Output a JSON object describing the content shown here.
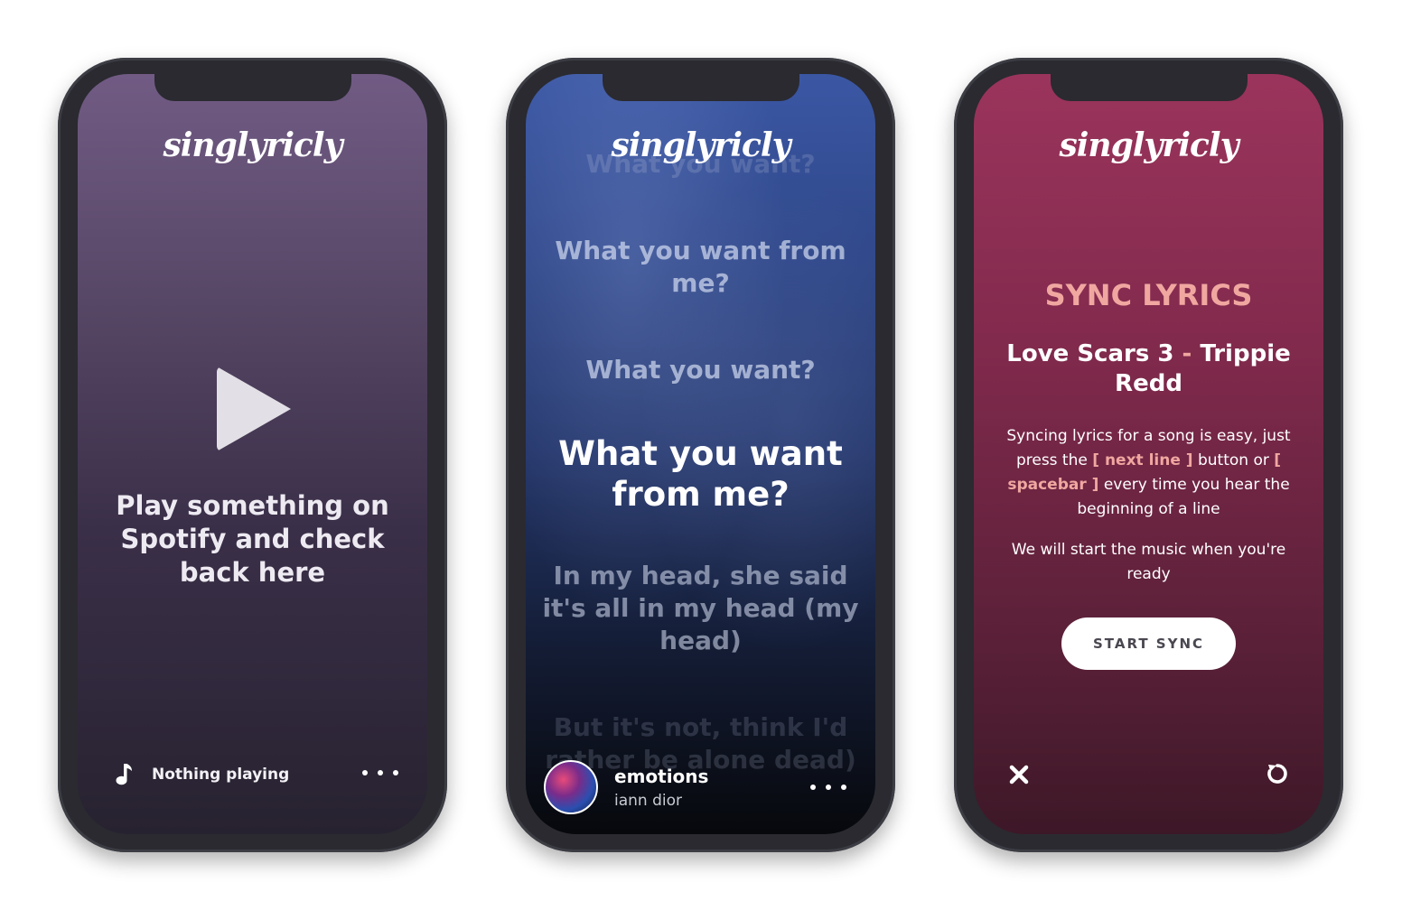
{
  "app": {
    "logo": "singlyricly"
  },
  "phone_idle": {
    "message": "Play something on Spotify and check back here",
    "footer": {
      "status": "Nothing playing"
    }
  },
  "phone_lyrics": {
    "lines": {
      "ghost": "What you want?",
      "prev1": "What you want from me?",
      "prev2": "What you want?",
      "current": "What you want from me?",
      "next1": "In my head, she said it's all in my head (my head)",
      "next2": "But it's not, think I'd rather be alone dead)"
    },
    "track": {
      "title": "emotions",
      "artist": "iann dior"
    }
  },
  "phone_sync": {
    "heading": "SYNC LYRICS",
    "song": {
      "name": "Love Scars 3",
      "separator": "-",
      "artist": "Trippie Redd"
    },
    "instructions": {
      "part1": "Syncing lyrics for a song is easy, just press the",
      "key1": "[ next line ]",
      "part2": "button or",
      "key2": "[ spacebar ]",
      "part3": "every time you hear the beginning of a line"
    },
    "ready": "We will start the music when you're ready",
    "start_button": "START SYNC"
  },
  "colors": {
    "sync_accent": "#f0a7a0",
    "idle_bg_top": "#715b84",
    "lyrics_bg_top": "#3b57a4",
    "sync_bg_top": "#9b345c"
  },
  "icons": [
    "play-icon",
    "music-note-icon",
    "more-icon",
    "album-art",
    "close-icon",
    "reset-icon"
  ]
}
